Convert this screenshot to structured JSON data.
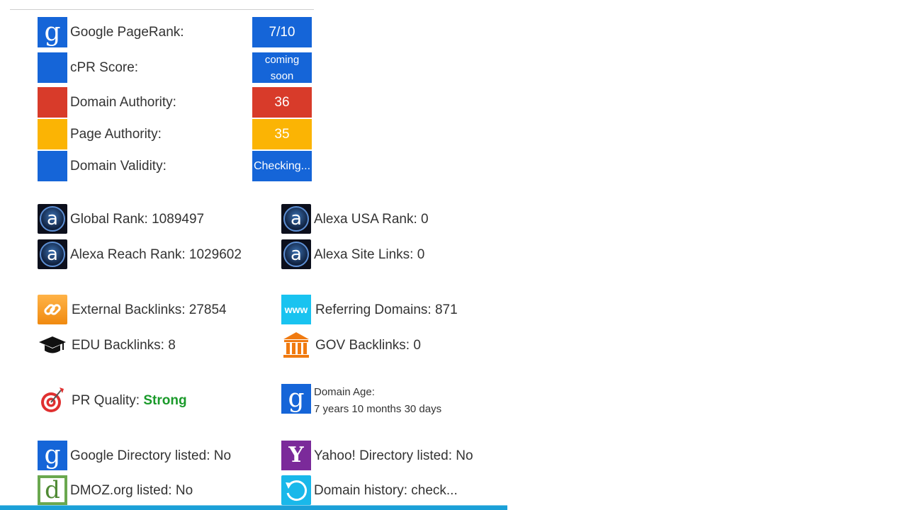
{
  "scores": [
    {
      "label": "Google PageRank:",
      "value": "7/10",
      "color": "#1565d8",
      "icon": "google-g-icon"
    },
    {
      "label": "cPR Score:",
      "value_line1": "coming",
      "value_line2": "soon",
      "color": "#1565d8"
    },
    {
      "label": "Domain Authority:",
      "value": "36",
      "color": "#d83b2a"
    },
    {
      "label": "Page Authority:",
      "value": "35",
      "color": "#fbb404"
    },
    {
      "label": "Domain Validity:",
      "value": "Checking...",
      "color": "#1565d8"
    }
  ],
  "alexa": {
    "global_rank": "Global Rank: 1089497",
    "usa_rank": "Alexa USA Rank: 0",
    "reach_rank": "Alexa Reach Rank: 1029602",
    "site_links": "Alexa Site Links: 0"
  },
  "backlinks": {
    "external": "External Backlinks: 27854",
    "referring_domains": "Referring Domains: 871",
    "edu": "EDU Backlinks: 8",
    "gov": "GOV Backlinks: 0"
  },
  "quality": {
    "pr_quality_label": "PR Quality:",
    "pr_quality_value": "Strong",
    "domain_age_label": "Domain Age:",
    "domain_age_value": "7 years 10 months 30 days"
  },
  "directories": {
    "google": "Google Directory listed: No",
    "yahoo": "Yahoo! Directory listed: No",
    "dmoz": "DMOZ.org listed: No",
    "history": "Domain history: check..."
  },
  "icons": {
    "google": "g",
    "alexa": "a",
    "www": "www",
    "yahoo": "Y",
    "dmoz": "d"
  },
  "colors": {
    "blue": "#1565d8",
    "red": "#d83b2a",
    "yellow": "#fbb404",
    "green": "#1a9a2a",
    "purple": "#7b2a9a",
    "cyan": "#1ba0d8"
  }
}
